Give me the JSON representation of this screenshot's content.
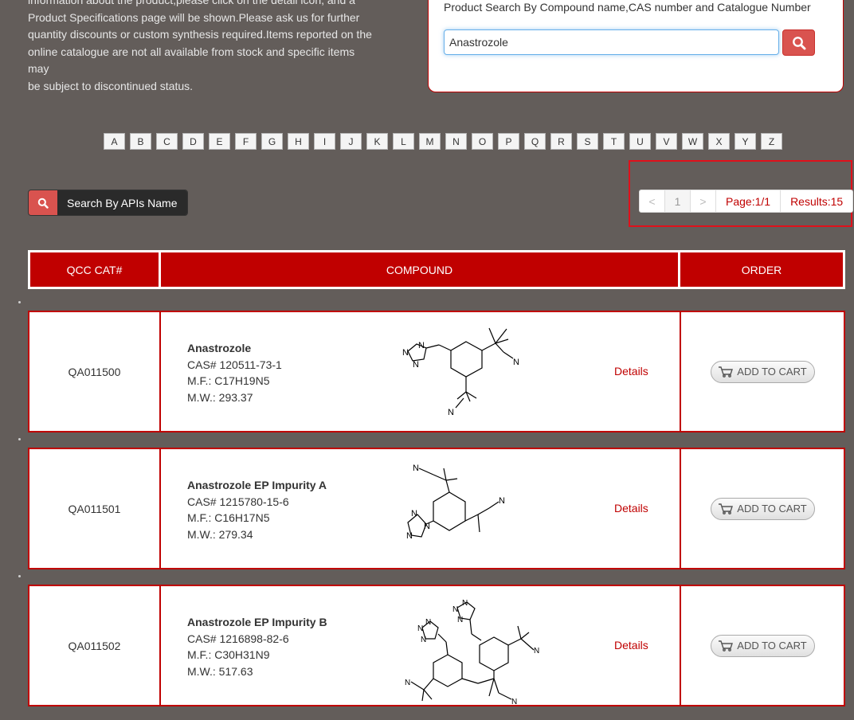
{
  "intro": {
    "lines": [
      "information about the product,please click on the detail icon, and a",
      "Product Specifications page will be shown.Please ask us for further",
      "quantity discounts or custom synthesis required.Items reported on the",
      "online catalogue are not all available from stock and specific items may",
      "be subject to discontinued status."
    ]
  },
  "search": {
    "title": "Product Search By Compound name,CAS number and Catalogue Number",
    "value": "Anastrozole",
    "button_icon": "search-icon"
  },
  "alphabet": [
    "A",
    "B",
    "C",
    "D",
    "E",
    "F",
    "G",
    "H",
    "I",
    "J",
    "K",
    "L",
    "M",
    "N",
    "O",
    "P",
    "Q",
    "R",
    "S",
    "T",
    "U",
    "V",
    "W",
    "X",
    "Y",
    "Z"
  ],
  "api_search": {
    "label": "Search By APIs Name",
    "icon": "search-icon"
  },
  "pagination": {
    "prev": "<",
    "current": "1",
    "next": ">",
    "page": "Page:1/1",
    "results": "Results:15"
  },
  "table": {
    "headers": [
      "QCC CAT#",
      "COMPOUND",
      "ORDER"
    ],
    "rows": [
      {
        "cat": "QA011500",
        "name": "Anastrozole",
        "cas": "CAS# 120511-73-1",
        "mf": "M.F.: C17H19N5",
        "mw": "M.W.: 293.37",
        "details": "Details",
        "cart": "ADD TO CART"
      },
      {
        "cat": "QA011501",
        "name": "Anastrozole EP Impurity A",
        "cas": "CAS# 1215780-15-6",
        "mf": "M.F.: C16H17N5",
        "mw": "M.W.: 279.34",
        "details": "Details",
        "cart": "ADD TO CART"
      },
      {
        "cat": "QA011502",
        "name": "Anastrozole EP Impurity B",
        "cas": "CAS# 1216898-82-6",
        "mf": "M.F.: C30H31N9",
        "mw": "M.W.: 517.63",
        "details": "Details",
        "cart": "ADD TO CART"
      }
    ]
  },
  "colors": {
    "background": "#635d5a",
    "accent": "#c00000",
    "search_button": "#d9534f"
  }
}
